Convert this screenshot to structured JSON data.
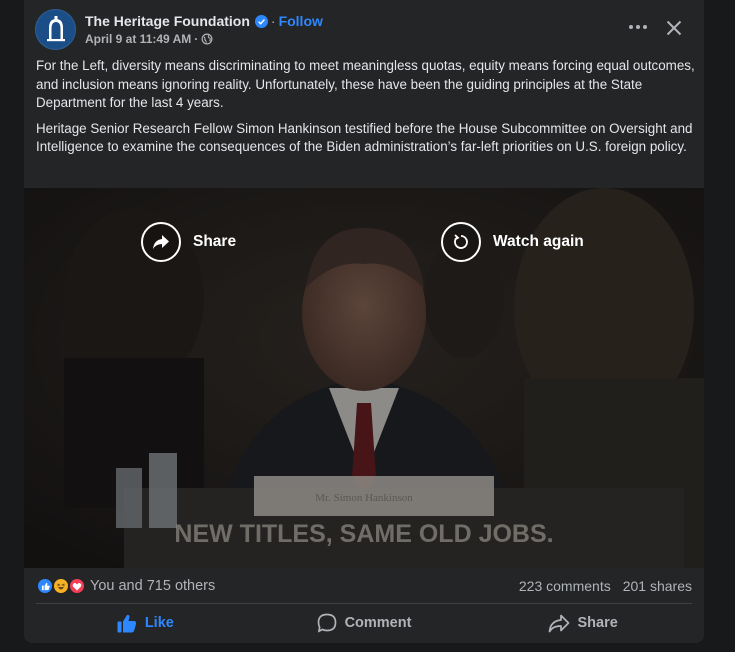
{
  "post": {
    "page_name": "The Heritage Foundation",
    "follow_separator": "·",
    "follow_label": "Follow",
    "timestamp": "April 9 at 11:49 AM",
    "timestamp_separator": "·",
    "paragraphs": [
      "For the Left, diversity means discriminating to meet meaningless quotas, equity means forcing equal outcomes, and inclusion means ignoring reality. Unfortunately, these have been the guiding principles at the State Department for the last 4 years.",
      "Heritage Senior Research Fellow Simon Hankinson testified before the House Subcommittee on Oversight and Intelligence to examine the consequences of the Biden administration’s far-left priorities on U.S. foreign policy."
    ]
  },
  "video": {
    "share_label": "Share",
    "watch_again_label": "Watch again",
    "nameplate": "Mr. Simon Hankinson",
    "caption": "NEW TITLES, SAME OLD JOBS."
  },
  "engagement": {
    "reactions_text": "You and 715 others",
    "comments": "223 comments",
    "shares": "201 shares",
    "reaction_icons": [
      "like-icon",
      "haha-icon",
      "love-icon"
    ]
  },
  "actions": {
    "like": "Like",
    "comment": "Comment",
    "share": "Share"
  },
  "colors": {
    "background": "#18191a",
    "card": "#242526",
    "accent": "#2d88ff",
    "text_primary": "#e4e6eb",
    "text_secondary": "#b0b3b8"
  }
}
